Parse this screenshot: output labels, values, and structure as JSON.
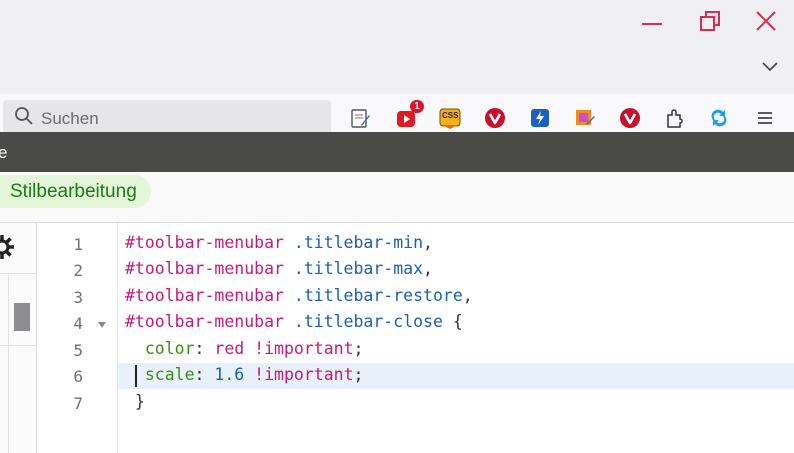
{
  "window": {
    "minimize_icon": "minimize-icon",
    "restore_icon": "restore-icon",
    "close_icon": "close-icon",
    "list_all_tabs_icon": "chevron-down-icon"
  },
  "toolbar": {
    "search_placeholder": "Suchen",
    "extensions": [
      {
        "name": "notepad-extension-icon"
      },
      {
        "name": "youtube-extension-icon",
        "badge": "1"
      },
      {
        "name": "css-extension-icon",
        "label": "CSS"
      },
      {
        "name": "vivaldi-extension-icon-1"
      },
      {
        "name": "bolt-extension-icon"
      },
      {
        "name": "image-edit-extension-icon"
      },
      {
        "name": "vivaldi-extension-icon-2"
      },
      {
        "name": "puzzle-extensions-icon"
      },
      {
        "name": "sync-icon"
      },
      {
        "name": "menu-icon"
      }
    ]
  },
  "devtools": {
    "title_fragment": "e",
    "active_tab": "Stilbearbeitung"
  },
  "editor": {
    "lines": [
      {
        "no": "1",
        "tokens": [
          {
            "t": "#toolbar-menubar",
            "c": "sel"
          },
          {
            "t": " ",
            "c": "pun"
          },
          {
            "t": ".titlebar-min",
            "c": "cls"
          },
          {
            "t": ",",
            "c": "pun"
          }
        ]
      },
      {
        "no": "2",
        "tokens": [
          {
            "t": "#toolbar-menubar",
            "c": "sel"
          },
          {
            "t": " ",
            "c": "pun"
          },
          {
            "t": ".titlebar-max",
            "c": "cls"
          },
          {
            "t": ",",
            "c": "pun"
          }
        ]
      },
      {
        "no": "3",
        "tokens": [
          {
            "t": "#toolbar-menubar",
            "c": "sel"
          },
          {
            "t": " ",
            "c": "pun"
          },
          {
            "t": ".titlebar-restore",
            "c": "cls"
          },
          {
            "t": ",",
            "c": "pun"
          }
        ]
      },
      {
        "no": "4",
        "tokens": [
          {
            "t": "#toolbar-menubar",
            "c": "sel"
          },
          {
            "t": " ",
            "c": "pun"
          },
          {
            "t": ".titlebar-close",
            "c": "cls"
          },
          {
            "t": " {",
            "c": "pun"
          }
        ]
      },
      {
        "no": "5",
        "tokens": [
          {
            "t": "  color",
            "c": "prop"
          },
          {
            "t": ": ",
            "c": "pun"
          },
          {
            "t": "red",
            "c": "val"
          },
          {
            "t": " ",
            "c": "pun"
          },
          {
            "t": "!important",
            "c": "val"
          },
          {
            "t": ";",
            "c": "pun"
          }
        ]
      },
      {
        "no": "6",
        "tokens": [
          {
            "t": "  scale",
            "c": "prop"
          },
          {
            "t": ": ",
            "c": "pun"
          },
          {
            "t": "1.6",
            "c": "num"
          },
          {
            "t": " ",
            "c": "pun"
          },
          {
            "t": "!important",
            "c": "val"
          },
          {
            "t": ";",
            "c": "pun"
          }
        ]
      },
      {
        "no": "7",
        "tokens": [
          {
            "t": " }",
            "c": "pun"
          }
        ]
      }
    ]
  },
  "colors": {
    "window_controls": "#e22850",
    "active_tab_bg": "#e3f7d8",
    "active_tab_text": "#1a7a18",
    "devbar_bg": "#4a4a48"
  }
}
